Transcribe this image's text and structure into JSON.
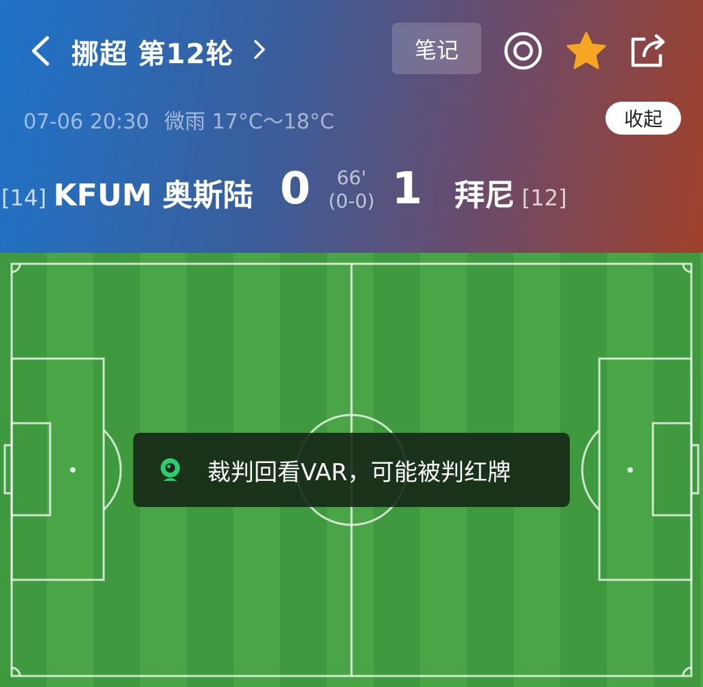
{
  "nav": {
    "back_icon": "chevron-left-icon",
    "title": "挪超 第12轮",
    "next_icon": "chevron-right-icon",
    "notes_label": "笔记",
    "live_icon": "target-icon",
    "favorite_icon": "star-icon",
    "share_icon": "share-icon"
  },
  "info": {
    "datetime": "07-06 20:30",
    "weather": "微雨 17°C～18°C",
    "collapse_label": "收起"
  },
  "match": {
    "home": {
      "rank": "[14]",
      "name": "KFUM 奥斯陆",
      "score": "0"
    },
    "away": {
      "rank": "[12]",
      "name": "拜尼",
      "score": "1"
    },
    "minute": "66'",
    "halftime": "(0-0)"
  },
  "toast": {
    "icon": "camera-icon",
    "text": "裁判回看VAR，可能被判红牌"
  },
  "colors": {
    "accent_star": "#f5a623",
    "toast_icon": "#2ecc71"
  }
}
